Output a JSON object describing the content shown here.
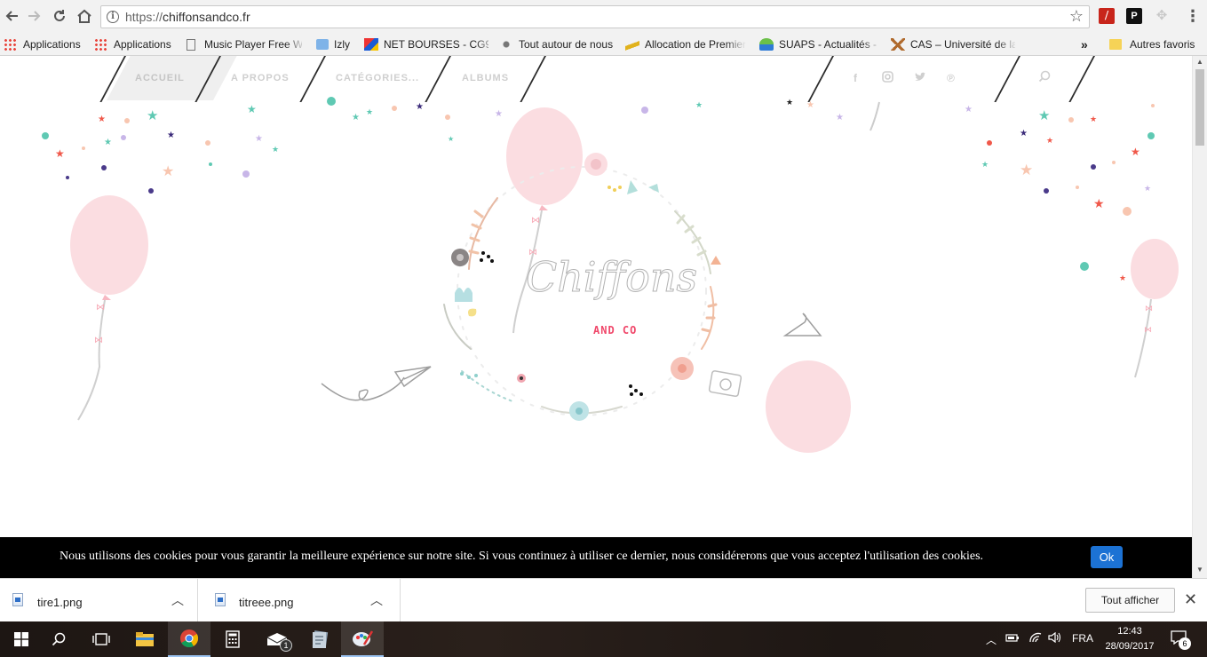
{
  "browser": {
    "url_protocol": "https://",
    "url_host": "chiffonsandco.fr",
    "bookmarks": [
      {
        "label": "Applications"
      },
      {
        "label": "Applications"
      },
      {
        "label": "Music Player Free Wi"
      },
      {
        "label": "Izly"
      },
      {
        "label": "NET BOURSES - CG97"
      },
      {
        "label": "Tout autour de nous"
      },
      {
        "label": "Allocation de Premier"
      },
      {
        "label": "SUAPS - Actualités - l"
      },
      {
        "label": "CAS – Université de la"
      }
    ],
    "bookmarks_overflow": "»",
    "other_bookmarks": "Autres favoris"
  },
  "site": {
    "nav": {
      "accueil": "ACCUEIL",
      "a_propos": "A PROPOS",
      "categories": "CATÉGORIES...",
      "albums": "ALBUMS"
    },
    "logo_main": "Chiffons",
    "logo_sub": "AND CO"
  },
  "cookie_bar": {
    "message": "Nous utilisons des cookies pour vous garantir la meilleure expérience sur notre site. Si vous continuez à utiliser ce dernier, nous considérerons que vous acceptez l'utilisation des cookies.",
    "ok_label": "Ok"
  },
  "downloads": {
    "items": [
      {
        "name": "tire1.png"
      },
      {
        "name": "titreee.png"
      }
    ],
    "show_all": "Tout afficher"
  },
  "taskbar": {
    "language": "FRA",
    "time": "12:43",
    "date": "28/09/2017",
    "mail_badge": "1",
    "notif_badge": "6"
  },
  "colors": {
    "balloon": "#fbdde1",
    "accent_blue": "#1c72d4",
    "logo_pink": "#f0476a"
  }
}
